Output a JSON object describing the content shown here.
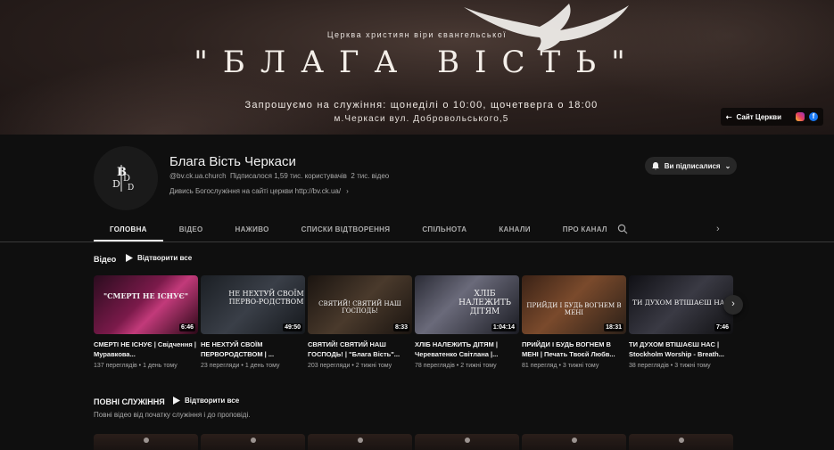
{
  "banner": {
    "subtitle": "Церква християн віри євангельської",
    "title": "\"БЛАГА ВІСТЬ\"",
    "schedule": "Запрошуємо на служіння: щонеділі о 10:00, щочетверга о 18:00",
    "address": "м.Черкаси вул. Добровольського,5",
    "site_link": "Сайт Церкви"
  },
  "channel": {
    "name": "Блага Вість Черкаси",
    "handle": "@bv.ck.ua.church",
    "subscribers": "Підписалося 1,59 тис. користувачів",
    "videos_count": "2 тис. відео",
    "link_text": "Дивись Богослужіння на сайті церкви http://bv.ck.ua/",
    "subscribe_label": "Ви підписалися"
  },
  "tabs": [
    "ГОЛОВНА",
    "ВІДЕО",
    "НАЖИВО",
    "СПИСКИ ВІДТВОРЕННЯ",
    "СПІЛЬНОТА",
    "КАНАЛИ",
    "ПРО КАНАЛ"
  ],
  "section_videos": {
    "title": "Відео",
    "play_all": "Відтворити все"
  },
  "videos": [
    {
      "title": "СМЕРТІ НЕ ІСНУЄ | Свідчення | Муравкова...",
      "duration": "6:46",
      "views": "137 переглядів",
      "age": "1 день тому",
      "thumb_text": "\"СМЕРТІ НЕ ІСНУЄ\"",
      "progress": 0
    },
    {
      "title": "НЕ НЕХТУЙ СВОЇМ ПЕРВОРОДСТВОМ | ...",
      "duration": "49:50",
      "views": "23 перегляди",
      "age": "1 день тому",
      "thumb_text": "НЕ НЕХТУЙ СВОЇМ ПЕРВО-РОДСТВОМ",
      "progress": 0
    },
    {
      "title": "СВЯТИЙ! СВЯТИЙ НАШ ГОСПОДЬ! | \"Блага Вість\"...",
      "duration": "8:33",
      "views": "203 перегляди",
      "age": "2 тижні тому",
      "thumb_text": "СВЯТИЙ! СВЯТИЙ НАШ ГОСПОДЬ!",
      "progress": 0
    },
    {
      "title": "ХЛІБ НАЛЕЖИТЬ ДІТЯМ | Череватенко Світлана |...",
      "duration": "1:04:14",
      "views": "78 переглядів",
      "age": "2 тижні тому",
      "thumb_text": "ХЛІБ НАЛЕЖИТЬ ДІТЯМ",
      "progress": 0
    },
    {
      "title": "ПРИЙДИ І БУДЬ ВОГНЕМ В МЕНІ | Печать Твоєй Любв...",
      "duration": "18:31",
      "views": "81 перегляд",
      "age": "3 тижні тому",
      "thumb_text": "ПРИЙДИ І БУДЬ ВОГНЕМ В МЕНІ",
      "progress": 0
    },
    {
      "title": "ТИ ДУХОМ ВТІШАЄШ НАС | Stockholm Worship - Breath...",
      "duration": "7:46",
      "views": "38 переглядів",
      "age": "3 тижні тому",
      "thumb_text": "ТИ ДУХОМ ВТІШАЄШ НАС",
      "progress": 0
    }
  ],
  "section_full": {
    "title": "ПОВНІ СЛУЖІННЯ",
    "play_all": "Відтворити все",
    "description": "Повні відео від початку служіння і до проповіді."
  },
  "icons": {
    "search": "search-icon",
    "bell": "bell-icon",
    "chevron": "chevron-right-icon"
  },
  "colors": {
    "background": "#0f0f0f",
    "accent": "#ff0000",
    "facebook": "#1877f2"
  }
}
